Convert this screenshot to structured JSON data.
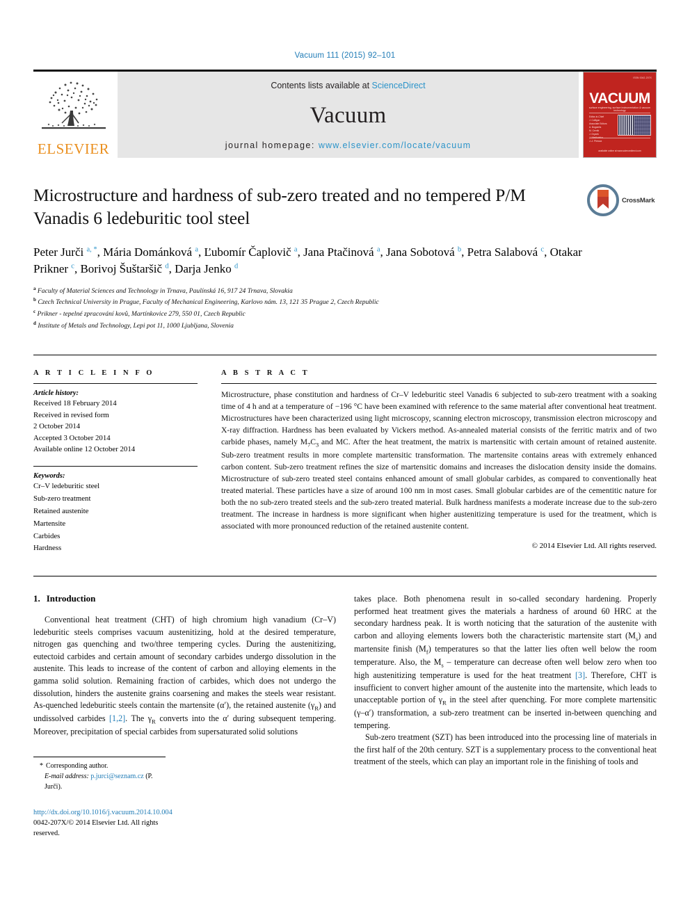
{
  "running_head": "Vacuum 111 (2015) 92–101",
  "masthead": {
    "publisher": "ELSEVIER",
    "contents_prefix": "Contents lists available at ",
    "contents_link": "ScienceDirect",
    "journal_name": "Vacuum",
    "homepage_prefix": "journal homepage: ",
    "homepage_url": "www.elsevier.com/locate/vacuum",
    "cover": {
      "issn": "ISSN 0042-207X",
      "title": "VACUUM",
      "subtitle": "surface engineering, surface instrumentation & vacuum technology",
      "editors": "Editor-in-Chief\nJ. Colligon\nAssociate Editors\nA. Bogaerts\nM. Cernik\nJ. Dryzek\nJ. Niedbalska\nJ.-J. Pireaux",
      "footer": "available online at www.sciencedirect.com"
    }
  },
  "crossmark": {
    "label": "CrossMark"
  },
  "title": "Microstructure and hardness of sub-zero treated and no tempered P/M Vanadis 6 ledeburitic tool steel",
  "authors_html": "Peter Jurči <sup>a, *</sup>, Mária Dománková <sup>a</sup>, Ľubomír Čaplovič <sup>a</sup>, Jana Ptačinová <sup>a</sup>, Jana Sobotová <sup>b</sup>, Petra Salabová <sup>c</sup>, Otakar Prikner <sup>c</sup>, Borivoj Šuštaršič <sup>d</sup>, Darja Jenko <sup>d</sup>",
  "affiliations": [
    {
      "marker": "a",
      "text": "Faculty of Material Sciences and Technology in Trnava, Paulínská 16, 917 24 Trnava, Slovakia"
    },
    {
      "marker": "b",
      "text": "Czech Technical University in Prague, Faculty of Mechanical Engineering, Karlovo nám. 13, 121 35 Prague 2, Czech Republic"
    },
    {
      "marker": "c",
      "text": "Prikner - tepelné zpracování kovů, Martínkovice 279, 550 01, Czech Republic"
    },
    {
      "marker": "d",
      "text": "Institute of Metals and Technology, Lepi pot 11, 1000 Ljubljana, Slovenia"
    }
  ],
  "article_info": {
    "heading": "A R T I C L E   I N F O",
    "history_label": "Article history:",
    "history": [
      "Received 18 February 2014",
      "Received in revised form",
      "2 October 2014",
      "Accepted 3 October 2014",
      "Available online 12 October 2014"
    ],
    "keywords_label": "Keywords:",
    "keywords": [
      "Cr–V ledeburitic steel",
      "Sub-zero treatment",
      "Retained austenite",
      "Martensite",
      "Carbides",
      "Hardness"
    ]
  },
  "abstract": {
    "heading": "A B S T R A C T",
    "text_html": "Microstructure, phase constitution and hardness of Cr–V ledeburitic steel Vanadis 6 subjected to sub-zero treatment with a soaking time of 4 h and at a temperature of −196 °C have been examined with reference to the same material after conventional heat treatment. Microstructures have been characterized using light microscopy, scanning electron microscopy, transmission electron microscopy and X-ray diffraction. Hardness has been evaluated by Vickers method. As-annealed material consists of the ferritic matrix and of two carbide phases, namely M<sub>7</sub>C<sub>3</sub> and MC. After the heat treatment, the matrix is martensitic with certain amount of retained austenite. Sub-zero treatment results in more complete martensitic transformation. The martensite contains areas with extremely enhanced carbon content. Sub-zero treatment refines the size of martensitic domains and increases the dislocation density inside the domains. Microstructure of sub-zero treated steel contains enhanced amount of small globular carbides, as compared to conventionally heat treated material. These particles have a size of around 100 nm in most cases. Small globular carbides are of the cementitic nature for both the no sub-zero treated steels and the sub-zero treated material. Bulk hardness manifests a moderate increase due to the sub-zero treatment. The increase in hardness is more significant when higher austenitizing temperature is used for the treatment, which is associated with more pronounced reduction of the retained austenite content.",
    "copyright": "© 2014 Elsevier Ltd. All rights reserved."
  },
  "section": {
    "number": "1.",
    "heading": "Introduction"
  },
  "body": {
    "left_p1_html": "Conventional heat treatment (CHT) of high chromium high vanadium (Cr–V) ledeburitic steels comprises vacuum austenitizing, hold at the desired temperature, nitrogen gas quenching and two/three tempering cycles. During the austenitizing, eutectoid carbides and certain amount of secondary carbides undergo dissolution in the austenite. This leads to increase of the content of carbon and alloying elements in the gamma solid solution. Remaining fraction of carbides, which does not undergo the dissolution, hinders the austenite grains coarsening and makes the steels wear resistant. As-quenched ledeburitic steels contain the martensite (α′), the retained austenite (γ<sub>R</sub>) and undissolved carbides <span class=\"cite\">[1,2]</span>. The γ<sub>R</sub> converts into the α′ during subsequent tempering. Moreover, precipitation of special carbides from supersaturated solid solutions",
    "right_p1_html": "takes place. Both phenomena result in so-called secondary hardening. Properly performed heat treatment gives the materials a hardness of around 60 HRC at the secondary hardness peak. It is worth noticing that the saturation of the austenite with carbon and alloying elements lowers both the characteristic martensite start (M<sub>s</sub>) and martensite finish (M<sub>f</sub>) temperatures so that the latter lies often well below the room temperature. Also, the M<sub>s</sub> – temperature can decrease often well below zero when too high austenitizing temperature is used for the heat treatment <span class=\"cite\">[3]</span>. Therefore, CHT is insufficient to convert higher amount of the austenite into the martensite, which leads to unacceptable portion of γ<sub>R</sub> in the steel after quenching. For more complete martensitic (γ–α′) transformation, a sub-zero treatment can be inserted in-between quenching and tempering.",
    "right_p2_html": "Sub-zero treatment (SZT) has been introduced into the processing line of materials in the first half of the 20th century. SZT is a supplementary process to the conventional heat treatment of the steels, which can play an important role in the finishing of tools and"
  },
  "footnote": {
    "corresponding": "Corresponding author.",
    "email_label": "E-mail address:",
    "email": "p.jurci@seznam.cz",
    "email_suffix": "(P. Jurči).",
    "doi": "http://dx.doi.org/10.1016/j.vacuum.2014.10.004",
    "issn_line": "0042-207X/© 2014 Elsevier Ltd. All rights reserved."
  },
  "colors": {
    "link_blue": "#1f7bb6",
    "sd_blue": "#2a93c9",
    "elsevier_orange": "#ea8f1e",
    "cover_red": "#c0241f"
  }
}
